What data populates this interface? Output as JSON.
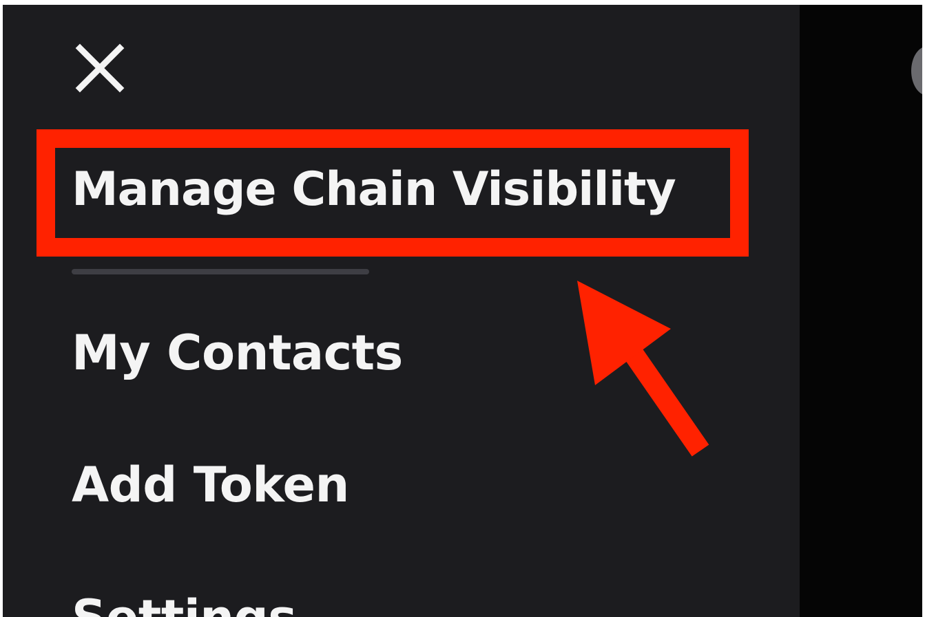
{
  "drawer": {
    "close_icon": "close-icon",
    "items": [
      {
        "label": "Manage Chain Visibility",
        "highlighted": true
      },
      {
        "label": "My Contacts"
      },
      {
        "label": "Add Token"
      },
      {
        "label": "Settings"
      }
    ]
  },
  "annotation": {
    "highlight_color": "#ff2200",
    "arrow_icon": "arrow-up-left-icon"
  },
  "colors": {
    "drawer_background": "#1c1c1f",
    "menu_text": "#f4f4f4",
    "divider": "#3e3e44",
    "backdrop": "#050505"
  }
}
